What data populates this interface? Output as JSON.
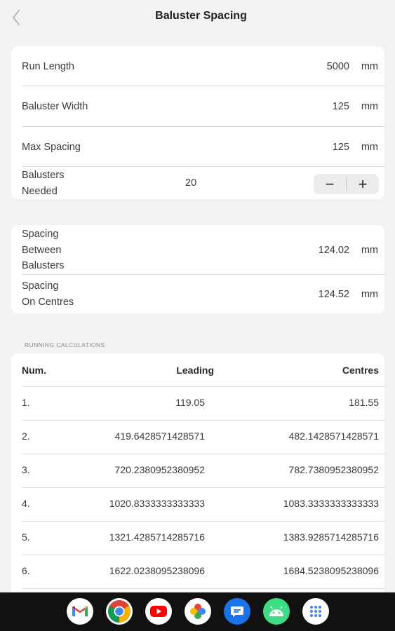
{
  "header": {
    "title": "Baluster Spacing",
    "back_icon": "chevron-left-icon"
  },
  "inputs": {
    "run_length": {
      "label": "Run Length",
      "value": "5000",
      "unit": "mm"
    },
    "baluster_width": {
      "label": "Baluster Width",
      "value": "125",
      "unit": "mm"
    },
    "max_spacing": {
      "label": "Max Spacing",
      "value": "125",
      "unit": "mm"
    },
    "balusters_needed": {
      "label_line1": "Balusters",
      "label_line2": "Needed",
      "value": "20",
      "minus": "−",
      "plus": "+"
    }
  },
  "results": {
    "spacing_between": {
      "label_line1": "Spacing",
      "label_line2": "Between",
      "label_line3": "Balusters",
      "value": "124.02",
      "unit": "mm"
    },
    "spacing_centres": {
      "label_line1": "Spacing",
      "label_line2": "On Centres",
      "value": "124.52",
      "unit": "mm"
    }
  },
  "running": {
    "section_title": "RUNNING CALCULATIONS",
    "headers": {
      "num": "Num.",
      "leading": "Leading",
      "centres": "Centres"
    },
    "rows": [
      {
        "num": "1.",
        "leading": "119.05",
        "centres": "181.55"
      },
      {
        "num": "2.",
        "leading": "419.6428571428571",
        "centres": "482.1428571428571"
      },
      {
        "num": "3.",
        "leading": "720.2380952380952",
        "centres": "782.7380952380952"
      },
      {
        "num": "4.",
        "leading": "1020.8333333333333",
        "centres": "1083.3333333333333"
      },
      {
        "num": "5.",
        "leading": "1321.4285714285716",
        "centres": "1383.9285714285716"
      },
      {
        "num": "6.",
        "leading": "1622.0238095238096",
        "centres": "1684.5238095238096"
      }
    ]
  },
  "taskbar": {
    "apps": [
      "gmail-icon",
      "chrome-icon",
      "youtube-icon",
      "photos-icon",
      "messages-icon",
      "android-icon",
      "app-drawer-icon"
    ]
  }
}
